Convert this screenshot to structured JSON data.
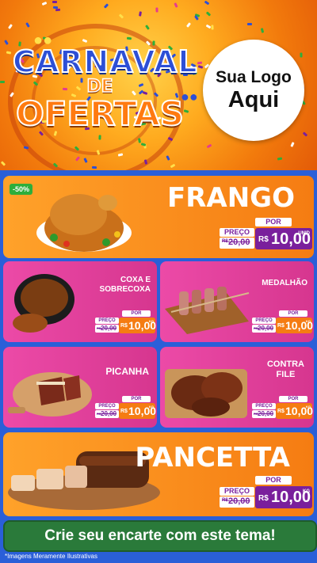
{
  "header": {
    "title_line1": "CARNAVAL",
    "title_line2": "DE",
    "title_line3": "OFERTAS",
    "logo_line1": "Sua Logo",
    "logo_line2": "Aqui"
  },
  "products": {
    "frango": {
      "name": "FRANGO",
      "badge": "-50%",
      "por": "POR",
      "preco": "PREÇO",
      "old_prefix": "R$",
      "old_price": "20,00",
      "currency": "R$",
      "price": "10,00",
      "unit": "UNID"
    },
    "coxa": {
      "name_line1": "COXA E",
      "name_line2": "SOBRECOXA",
      "por": "POR",
      "preco": "PREÇO",
      "old_prefix": "R$",
      "old_price": "20,00",
      "currency": "R$",
      "price": "10,00",
      "unit": "KG"
    },
    "medalhao": {
      "name": "MEDALHÃO",
      "por": "POR",
      "preco": "PREÇO",
      "old_prefix": "R$",
      "old_price": "20,00",
      "currency": "R$",
      "price": "10,00",
      "unit": "KG"
    },
    "picanha": {
      "name": "PICANHA",
      "por": "POR",
      "preco": "PREÇO",
      "old_prefix": "R$",
      "old_price": "20,00",
      "currency": "R$",
      "price": "10,00",
      "unit": "KG"
    },
    "contrafile": {
      "name_line1": "CONTRA",
      "name_line2": "FILE",
      "por": "POR",
      "preco": "PREÇO",
      "old_prefix": "R$",
      "old_price": "20,00",
      "currency": "R$",
      "price": "10,00",
      "unit": "KG"
    },
    "pancetta": {
      "name": "PANCETTA",
      "por": "POR",
      "preco": "PREÇO",
      "old_prefix": "R$",
      "old_price": "20,00",
      "currency": "R$",
      "price": "10,00",
      "unit": "KG"
    }
  },
  "footer": {
    "cta": "Crie seu encarte com este tema!",
    "disclaimer": "*Imagens Meramente Ilustrativas"
  },
  "colors": {
    "orange": "#f57c12",
    "pink": "#d6368f",
    "purple": "#7a1f9c",
    "blue": "#2a5fd8",
    "green": "#2a7a3a"
  },
  "icons": [
    "carnival-mask-icon",
    "confetti"
  ]
}
